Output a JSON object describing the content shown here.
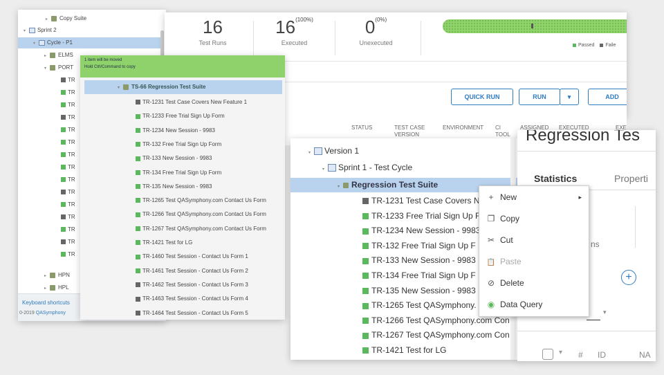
{
  "left_tree": {
    "items": [
      {
        "text": "Copy Suite"
      },
      {
        "text": "Sprint 2"
      },
      {
        "text": "Cycle - P1"
      },
      {
        "text": "ELMS"
      },
      {
        "text": "PORT"
      },
      {
        "text": "TR"
      },
      {
        "text": "TR"
      },
      {
        "text": "TR"
      },
      {
        "text": "TR"
      },
      {
        "text": "TR"
      },
      {
        "text": "TR"
      },
      {
        "text": "TR"
      },
      {
        "text": "TR"
      },
      {
        "text": "TR"
      },
      {
        "text": "TR"
      },
      {
        "text": "TR"
      },
      {
        "text": "TR"
      },
      {
        "text": "TR"
      },
      {
        "text": "TR"
      },
      {
        "text": "TR"
      },
      {
        "text": "HPN"
      },
      {
        "text": "HPL"
      }
    ],
    "footer_link": "Keyboard shortcuts",
    "footer_copy": "0-2019",
    "footer_brand": "QASymphony"
  },
  "stats": {
    "test_runs": {
      "value": "16",
      "label": "Test Runs"
    },
    "executed": {
      "value": "16",
      "pct": "(100%)",
      "label": "Executed"
    },
    "unexecuted": {
      "value": "0",
      "pct": "(0%)",
      "label": "Unexecuted"
    },
    "legend_passed": "Passed",
    "legend_failed": "Faile"
  },
  "toolbar": {
    "quick_run": "QUICK RUN",
    "run": "RUN",
    "add": "ADD"
  },
  "columns": [
    "STATUS",
    "TEST CASE VERSION",
    "ENVIRONMENT",
    "CI TOOL",
    "ASSIGNED TO",
    "EXECUTED START",
    "EXE"
  ],
  "drag_popup": {
    "header_line1": "1 item will be moved",
    "header_line2": "Hold Ctrl/Command to copy",
    "suite": "TS-66 Regression Test Suite",
    "items": [
      {
        "text": "TR-1231 Test Case Covers New Feature 1",
        "status": "dark"
      },
      {
        "text": "TR-1233 Free Trial Sign Up Form",
        "status": "green"
      },
      {
        "text": "TR-1234 New Session - 9983",
        "status": "green"
      },
      {
        "text": "TR-132 Free Trial Sign Up Form",
        "status": "green"
      },
      {
        "text": "TR-133 New Session - 9983",
        "status": "green"
      },
      {
        "text": "TR-134 Free Trial Sign Up Form",
        "status": "green"
      },
      {
        "text": "TR-135 New Session - 9983",
        "status": "green"
      },
      {
        "text": "TR-1265 Test QASymphony.com Contact Us Form",
        "status": "green"
      },
      {
        "text": "TR-1266 Test QASymphony.com Contact Us Form",
        "status": "green"
      },
      {
        "text": "TR-1267 Test QASymphony.com Contact Us Form",
        "status": "green"
      },
      {
        "text": "TR-1421 Test for LG",
        "status": "green"
      },
      {
        "text": "TR-1460 Test Session - Contact Us Form 1",
        "status": "green"
      },
      {
        "text": "TR-1461 Test Session - Contact Us Form 2",
        "status": "green"
      },
      {
        "text": "TR-1462 Test Session - Contact Us Form 3",
        "status": "dark"
      },
      {
        "text": "TR-1463 Test Session - Contact Us Form 4",
        "status": "dark"
      },
      {
        "text": "TR-1464 Test Session - Contact Us Form 5",
        "status": "dark"
      }
    ]
  },
  "main_tree": {
    "version": "Version 1",
    "cycle": "Sprint 1 - Test Cycle",
    "suite": "Regression Test Suite",
    "items": [
      {
        "text": "TR-1231 Test Case Covers N",
        "status": "dark"
      },
      {
        "text": "TR-1233 Free Trial Sign Up F",
        "status": "green"
      },
      {
        "text": "TR-1234 New Session - 9983",
        "status": "green"
      },
      {
        "text": "TR-132 Free Trial Sign Up F",
        "status": "green"
      },
      {
        "text": "TR-133 New Session - 9983",
        "status": "green"
      },
      {
        "text": "TR-134 Free Trial Sign Up F",
        "status": "green"
      },
      {
        "text": "TR-135 New Session - 9983",
        "status": "green"
      },
      {
        "text": "TR-1265 Test QASymphony.",
        "status": "green"
      },
      {
        "text": "TR-1266 Test QASymphony.com Con",
        "status": "green"
      },
      {
        "text": "TR-1267 Test QASymphony.com Con",
        "status": "green"
      },
      {
        "text": "TR-1421 Test for LG",
        "status": "green"
      }
    ]
  },
  "right_panel": {
    "title": "Regression Tes",
    "tab_statistics": "Statistics",
    "tab_properties": "Properti",
    "big_num": "6",
    "sub_label": "ns",
    "col_sort": "#",
    "col_id": "ID",
    "col_na": "NA"
  },
  "context_menu": {
    "items": [
      {
        "label": "New",
        "icon": "+"
      },
      {
        "label": "Copy",
        "icon": "❐"
      },
      {
        "label": "Cut",
        "icon": "✂"
      },
      {
        "label": "Paste",
        "icon": "📋"
      },
      {
        "label": "Delete",
        "icon": "⊘"
      },
      {
        "label": "Data Query",
        "icon": "◉"
      }
    ]
  },
  "colors": {
    "green": "#5cb85c",
    "dark": "#666666",
    "accent": "#2f7bbf",
    "selected": "#b9d3ee"
  }
}
